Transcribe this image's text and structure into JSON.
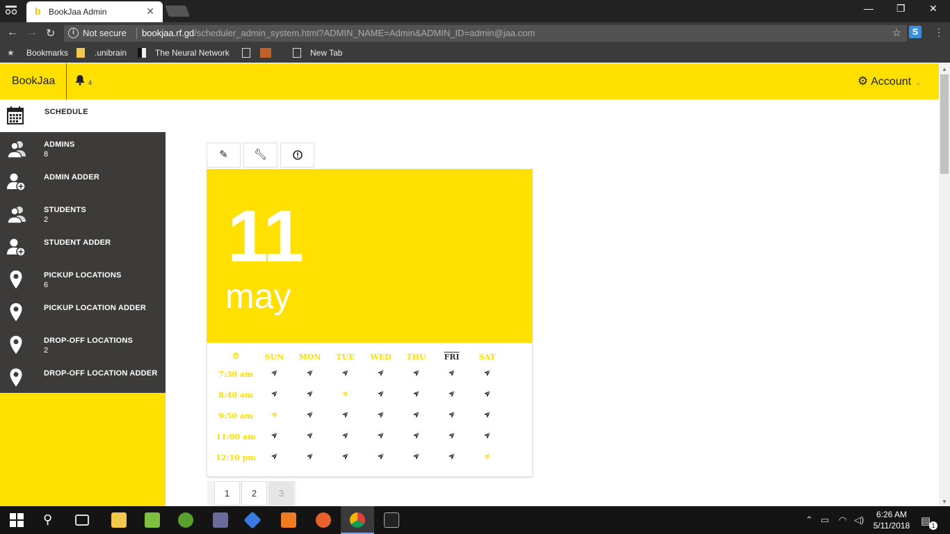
{
  "browser": {
    "tab_title": "BookJaa Admin",
    "security": "Not secure",
    "url_host": "bookjaa.rf.gd",
    "url_path": "/scheduler_admin_system.html?ADMIN_NAME=Admin&ADMIN_ID=admin@jaa.com",
    "bookmarks": [
      "Bookmarks",
      ".unibrain",
      "The Neural Network",
      "New Tab"
    ]
  },
  "header": {
    "brand": "BookJaa",
    "notification_count": "4",
    "account_label": "Account"
  },
  "sidebar": {
    "schedule_label": "SCHEDULE",
    "items": [
      {
        "label": "ADMINS",
        "count": "8",
        "icon": "users-icon"
      },
      {
        "label": "ADMIN ADDER",
        "count": "",
        "icon": "user-add-icon"
      },
      {
        "label": "STUDENTS",
        "count": "2",
        "icon": "users-icon"
      },
      {
        "label": "STUDENT ADDER",
        "count": "",
        "icon": "user-add-icon"
      },
      {
        "label": "PICKUP LOCATIONS",
        "count": "6",
        "icon": "location-pin-icon"
      },
      {
        "label": "PICKUP LOCATION ADDER",
        "count": "",
        "icon": "location-pin-icon"
      },
      {
        "label": "DROP-OFF LOCATIONS",
        "count": "2",
        "icon": "location-pin-icon"
      },
      {
        "label": "DROP-OFF LOCATION ADDER",
        "count": "",
        "icon": "location-pin-icon"
      }
    ]
  },
  "date": {
    "day": "11",
    "month": "may"
  },
  "calendar": {
    "days": [
      "SUN",
      "MON",
      "TUE",
      "WED",
      "THU",
      "FRI",
      "SAT"
    ],
    "today_index": 5,
    "times": [
      "7:30 am",
      "8:40 am",
      "9:50 am",
      "11:00 am",
      "12:10 pm"
    ],
    "booked": [
      [
        false,
        false,
        false,
        false,
        false,
        false,
        false
      ],
      [
        false,
        false,
        true,
        false,
        false,
        false,
        false
      ],
      [
        true,
        false,
        false,
        false,
        false,
        false,
        false
      ],
      [
        false,
        false,
        false,
        false,
        false,
        false,
        false
      ],
      [
        false,
        false,
        false,
        false,
        false,
        false,
        true
      ]
    ]
  },
  "pagination": [
    "1",
    "2",
    "3"
  ],
  "taskbar": {
    "time": "6:26 AM",
    "date": "5/11/2018",
    "notifications": "1"
  },
  "colors": {
    "brand_yellow": "#ffe000",
    "sidebar_dark": "#3c3b3a"
  }
}
